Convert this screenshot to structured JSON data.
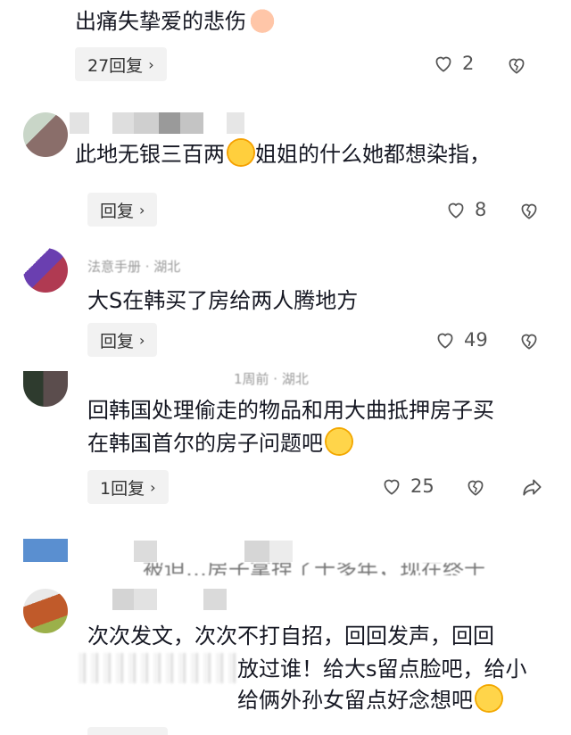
{
  "comments": [
    {
      "text": "出痛失挚爱的悲伤",
      "reply_label": "27回复",
      "likes": "2"
    },
    {
      "text": "此地无银三百两",
      "text_after": "姐姐的什么她都想染指，",
      "reply_label": "回复",
      "likes": "8"
    },
    {
      "meta": "法意手册 · 湖北",
      "text": "大S在韩买了房给两人腾地方",
      "reply_label": "回复",
      "likes": "49"
    },
    {
      "meta": "1周前 · 湖北",
      "text_line1": "回韩国处理偷走的物品和用大曲抵押房子买",
      "text_line2": "在韩国首尔的房子问题吧",
      "reply_label": "1回复",
      "likes": "25"
    },
    {
      "partial": "被迫…房子拿捏了十多年，现在终于"
    },
    {
      "line1": "次次发文，次次不打自招，回回发声，回回",
      "line2": "放过谁！给大s留点脸吧，给小",
      "line3": "给俩外孙女留点好念想吧"
    }
  ],
  "icons": {
    "like": "heart-outline-icon",
    "dislike": "broken-heart-icon",
    "share": "share-arrow-icon",
    "chevron": "chevron-right-icon"
  }
}
